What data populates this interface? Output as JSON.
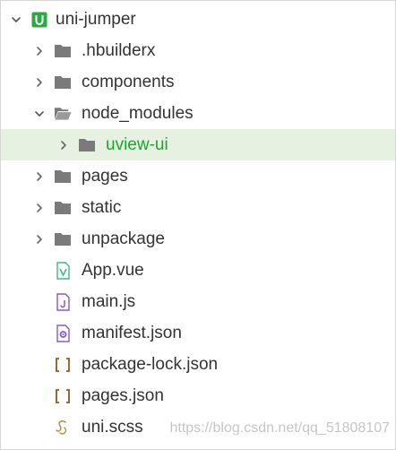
{
  "tree": {
    "root": {
      "label": "uni-jumper",
      "icon": "uniapp-project-icon",
      "expanded": true
    },
    "items": [
      {
        "label": ".hbuilderx",
        "type": "folder",
        "expanded": false
      },
      {
        "label": "components",
        "type": "folder",
        "expanded": false
      },
      {
        "label": "node_modules",
        "type": "folder",
        "expanded": true
      },
      {
        "label": "uview-ui",
        "type": "folder",
        "expanded": false,
        "selected": true
      },
      {
        "label": "pages",
        "type": "folder",
        "expanded": false
      },
      {
        "label": "static",
        "type": "folder",
        "expanded": false
      },
      {
        "label": "unpackage",
        "type": "folder",
        "expanded": false
      },
      {
        "label": "App.vue",
        "type": "vue-file"
      },
      {
        "label": "main.js",
        "type": "js-file"
      },
      {
        "label": "manifest.json",
        "type": "manifest-file"
      },
      {
        "label": "package-lock.json",
        "type": "json-file"
      },
      {
        "label": "pages.json",
        "type": "json-file"
      },
      {
        "label": "uni.scss",
        "type": "scss-file"
      }
    ]
  },
  "watermark": "https://blog.csdn.net/qq_51808107",
  "colors": {
    "folder": "#7a7a7a",
    "selection_bg": "#e6f1e2",
    "selected_text": "#19a82d",
    "project_green": "#2fa743",
    "vue_green": "#41b883",
    "js_purple": "#8a58c7",
    "json_brown": "#8a5a22"
  }
}
